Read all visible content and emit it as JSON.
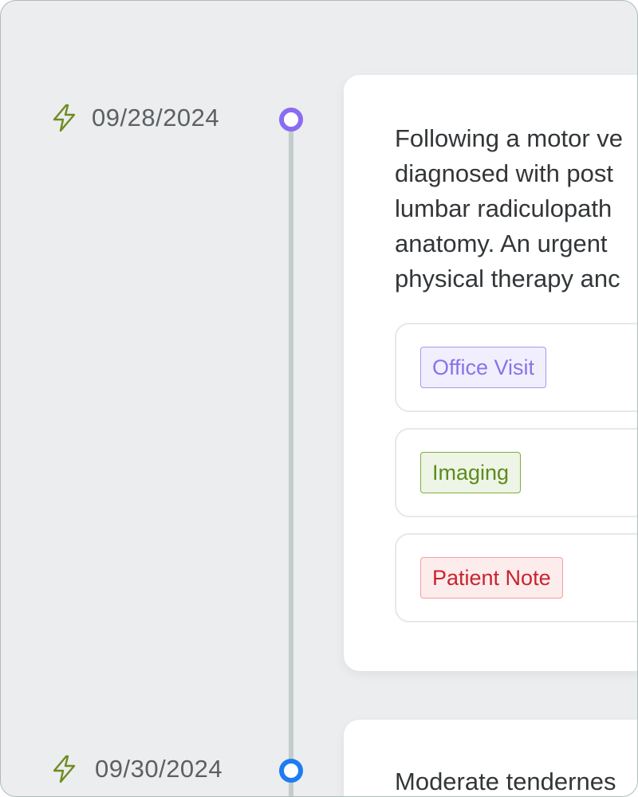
{
  "timeline": {
    "entries": [
      {
        "date": "09/28/2024",
        "icon": "lightning-bolt-icon",
        "node_color": "#8b6cf0",
        "summary_lines": [
          "Following a motor ve",
          "diagnosed with post",
          "lumbar radiculopath",
          "anatomy. An urgent",
          "physical therapy anc"
        ],
        "records": [
          {
            "label": "Office Visit",
            "color": "#8b72ea"
          },
          {
            "label": "Imaging",
            "color": "#5d8a1e"
          },
          {
            "label": "Patient Note",
            "color": "#c8242e"
          }
        ]
      },
      {
        "date": "09/30/2024",
        "icon": "lightning-bolt-icon",
        "node_color": "#1e7cf2",
        "summary_lines": [
          "Moderate tendernes"
        ]
      }
    ]
  }
}
